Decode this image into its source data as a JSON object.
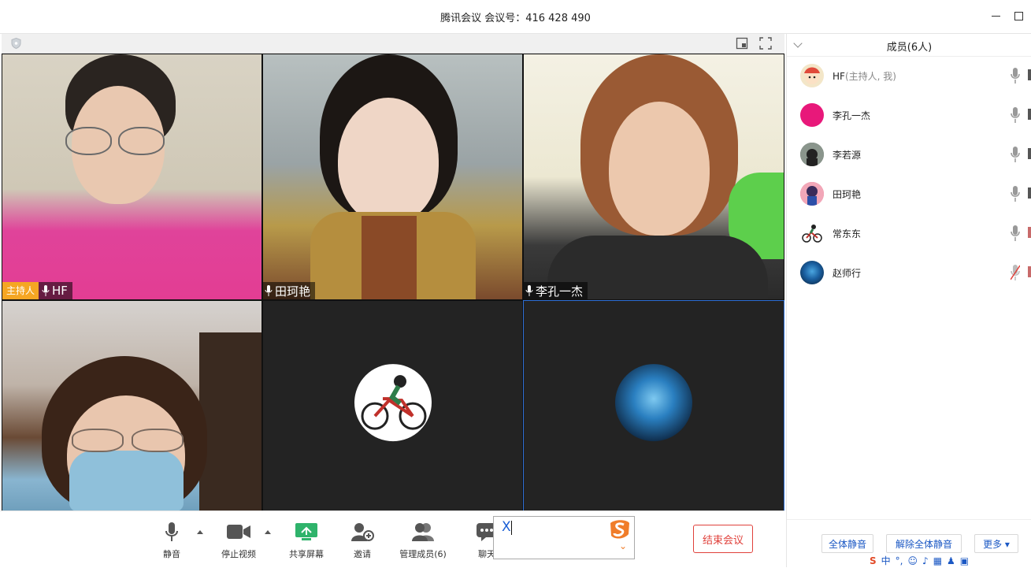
{
  "window": {
    "title": "腾讯会议 会议号：416 428 490"
  },
  "video_tiles": [
    {
      "name": "HF",
      "host_badge": "主持人"
    },
    {
      "name": "田珂艳"
    },
    {
      "name": "李孔一杰"
    },
    {
      "name": ""
    },
    {
      "name": ""
    },
    {
      "name": ""
    }
  ],
  "controls": {
    "mute": "静音",
    "stop_video": "停止视频",
    "share_screen": "共享屏幕",
    "invite": "邀请",
    "manage_members": "管理成员(6)",
    "chat": "聊天",
    "end_meeting": "结束会议"
  },
  "ime": {
    "input": "X"
  },
  "panel": {
    "title": "成员(6人)",
    "members": [
      {
        "name": "HF",
        "role": "(主持人, 我)",
        "avatar_color": "#f3e6c8",
        "muted": false
      },
      {
        "name": "李孔一杰",
        "role": "",
        "avatar_color": "#e8187a",
        "muted": false
      },
      {
        "name": "李若源",
        "role": "",
        "avatar_color": "#6b7a6f",
        "muted": false
      },
      {
        "name": "田珂艳",
        "role": "",
        "avatar_color": "#e86a8a",
        "muted": false
      },
      {
        "name": "常东东",
        "role": "",
        "avatar_color": "#ffffff",
        "muted": false
      },
      {
        "name": "赵师行",
        "role": "",
        "avatar_color": "#1a5fa0",
        "muted": true
      }
    ],
    "footer": {
      "mute_all": "全体静音",
      "unmute_all": "解除全体静音",
      "more": "更多 ▾"
    }
  },
  "colors": {
    "accent": "#1b58c4",
    "end_red": "#e0413b",
    "host_badge": "#f5a623",
    "share_green": "#2fb36b"
  },
  "icons": {
    "shield": "shield-icon",
    "layout": "layout-icon",
    "fullscreen": "fullscreen-icon"
  }
}
